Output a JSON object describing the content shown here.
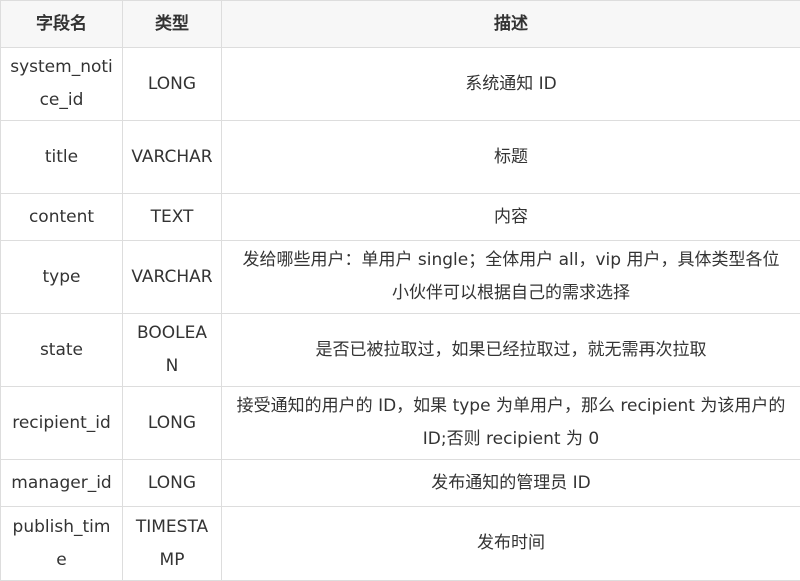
{
  "table": {
    "headers": [
      "字段名",
      "类型",
      "描述"
    ],
    "rows": [
      {
        "field": "system_notice_id",
        "type": "LONG",
        "desc": "系统通知 ID"
      },
      {
        "field": "title",
        "type": "VARCHAR",
        "desc": "标题"
      },
      {
        "field": "content",
        "type": "TEXT",
        "desc": "内容"
      },
      {
        "field": "type",
        "type": "VARCHAR",
        "desc": "发给哪些用户：单用户 single；全体用户 all，vip 用户，具体类型各位小伙伴可以根据自己的需求选择"
      },
      {
        "field": "state",
        "type": "BOOLEAN",
        "desc": "是否已被拉取过，如果已经拉取过，就无需再次拉取"
      },
      {
        "field": "recipient_id",
        "type": "LONG",
        "desc": "接受通知的用户的 ID，如果 type 为单用户，那么 recipient 为该用户的 ID;否则 recipient 为 0"
      },
      {
        "field": "manager_id",
        "type": "LONG",
        "desc": "发布通知的管理员 ID"
      },
      {
        "field": "publish_time",
        "type": "TIMESTAMP",
        "desc": "发布时间"
      }
    ]
  }
}
